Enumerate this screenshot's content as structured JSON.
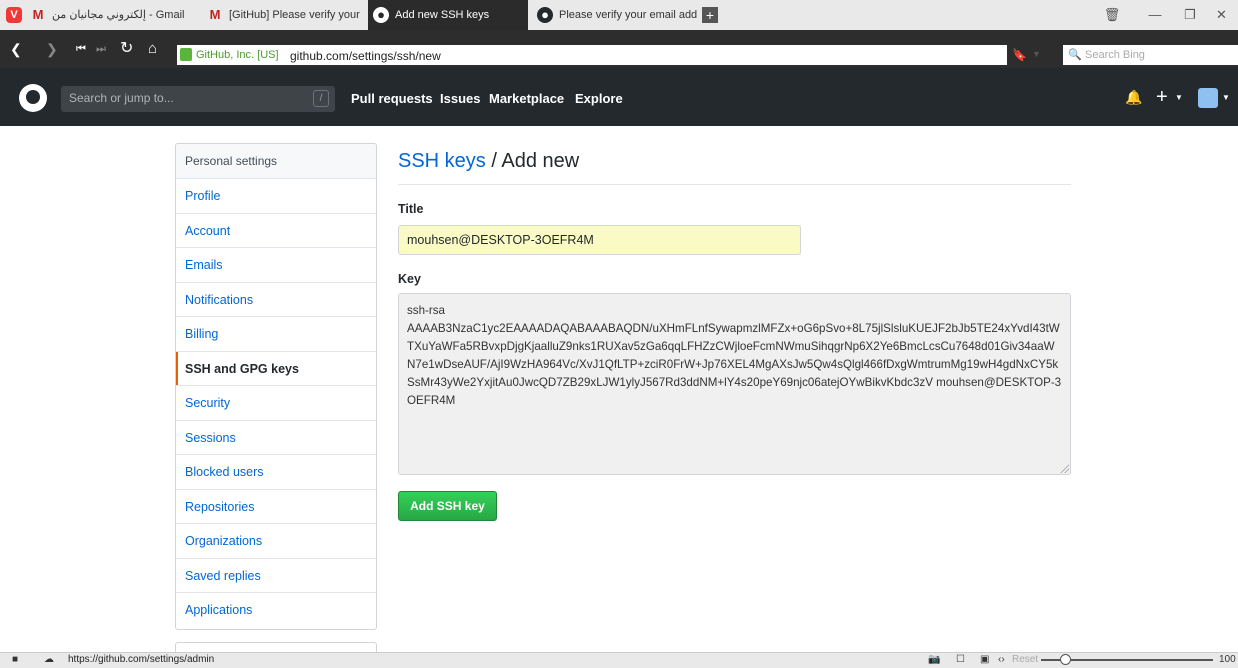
{
  "browser": {
    "tabs": [
      {
        "label": "إلكتروني مجانيان من - Gmail",
        "icon": "gmail-icon"
      },
      {
        "label": "[GitHub] Please verify your",
        "icon": "gmail-icon"
      },
      {
        "label": "Add new SSH keys",
        "icon": "github-icon",
        "active": true
      },
      {
        "label": "Please verify your email add",
        "icon": "github-icon"
      }
    ],
    "new_tab": "+",
    "cert_label": "GitHub, Inc. [US]",
    "url": "github.com/settings/ssh/new",
    "search_placeholder": "Search Bing",
    "status_url": "https://github.com/settings/admin",
    "reset_label": "Reset",
    "zoom": "100"
  },
  "header": {
    "search_placeholder": "Search or jump to...",
    "slash_hint": "/",
    "nav": [
      "Pull requests",
      "Issues",
      "Marketplace",
      "Explore"
    ]
  },
  "sidebar": {
    "heading": "Personal settings",
    "items": [
      {
        "label": "Profile"
      },
      {
        "label": "Account"
      },
      {
        "label": "Emails"
      },
      {
        "label": "Notifications"
      },
      {
        "label": "Billing"
      },
      {
        "label": "SSH and GPG keys",
        "selected": true
      },
      {
        "label": "Security"
      },
      {
        "label": "Sessions"
      },
      {
        "label": "Blocked users"
      },
      {
        "label": "Repositories"
      },
      {
        "label": "Organizations"
      },
      {
        "label": "Saved replies"
      },
      {
        "label": "Applications"
      }
    ]
  },
  "main": {
    "title_link": "SSH keys",
    "title_rest": " / Add new",
    "title_label": "Title",
    "title_value": "mouhsen@DESKTOP-3OEFR4M",
    "key_label": "Key",
    "key_value": "ssh-rsa\nAAAAB3NzaC1yc2EAAAADAQABAAABAQDN/uXHmFLnfSywapmzlMFZx+oG6pSvo+8L75jlSlsluKUEJF2bJb5TE24xYvdI43tWTXuYaWFa5RBvxpDjgKjaalluZ9nks1RUXav5zGa6qqLFHZzCWjloeFcmNWmuSihqgrNp6X2Ye6BmcLcsCu7648d01Giv34aaWN7e1wDseAUF/AjI9WzHA964Vc/XvJ1QfLTP+zciR0FrW+Jp76XEL4MgAXsJw5Qw4sQlgl466fDxgWmtrumMg19wH4gdNxCY5kSsMr43yWe2YxjitAu0JwcQD7ZB29xLJW1ylyJ567Rd3ddNM+lY4s20peY69njc06atejOYwBikvKbdc3zV mouhsen@DESKTOP-3OEFR4M",
    "submit_label": "Add SSH key"
  }
}
